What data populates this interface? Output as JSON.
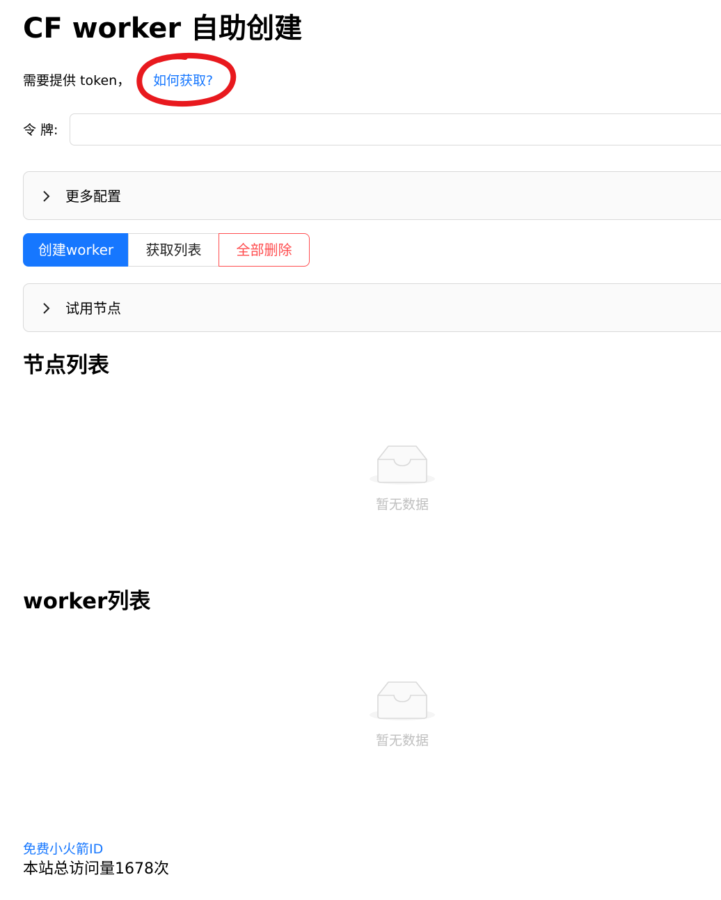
{
  "page": {
    "title": "CF worker 自助创建"
  },
  "intro": {
    "text": "需要提供 token，",
    "howto_link": "如何获取?",
    "annotation_color": "#e8191e"
  },
  "token": {
    "label": "令 牌:",
    "value": "",
    "placeholder": ""
  },
  "more_config": {
    "label": "更多配置",
    "icon": "chevron-right-icon",
    "expanded": false
  },
  "actions": {
    "create_label": "创建worker",
    "list_label": "获取列表",
    "delete_all_label": "全部删除"
  },
  "trial_nodes": {
    "label": "试用节点",
    "icon": "chevron-right-icon",
    "expanded": false
  },
  "node_list": {
    "title": "节点列表",
    "empty_text": "暂无数据",
    "empty_icon": "empty-inbox-icon"
  },
  "worker_list": {
    "title": "worker列表",
    "empty_text": "暂无数据",
    "empty_icon": "empty-inbox-icon"
  },
  "footer": {
    "link": "免费小火箭ID",
    "visits": "本站总访问量1678次"
  },
  "colors": {
    "primary": "#1677ff",
    "danger": "#ff4d4f",
    "empty_text": "#bfbfbf",
    "panel_bg": "#fafafa",
    "border": "#d9d9d9"
  }
}
